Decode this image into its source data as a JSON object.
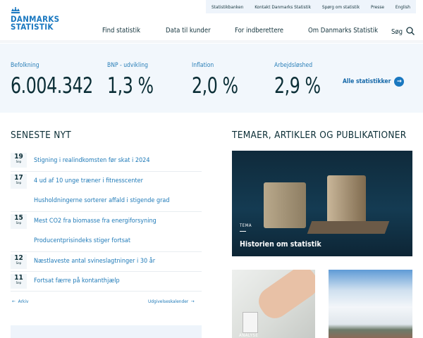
{
  "utility_nav": [
    "Statistikbanken",
    "Kontakt Danmarks Statistik",
    "Spørg om statistik",
    "Presse",
    "English"
  ],
  "logo": {
    "line1": "DANMARKS",
    "line2": "STATISTIK"
  },
  "main_nav": [
    "Find statistik",
    "Data til kunder",
    "For indberettere",
    "Om Danmarks Statistik"
  ],
  "search_label": "Søg",
  "stats": [
    {
      "label": "Befolkning",
      "value": "6.004.342"
    },
    {
      "label": "BNP - udvikling",
      "value": "1,3 %"
    },
    {
      "label": "Inflation",
      "value": "2,0 %"
    },
    {
      "label": "Arbejdsløshed",
      "value": "2,9 %"
    }
  ],
  "all_stats_label": "Alle statistikker",
  "news": {
    "heading": "SENESTE NYT",
    "items": [
      {
        "day": "19",
        "month": "Sep",
        "title": "Stigning i realindkomsten før skat i 2024"
      },
      {
        "day": "17",
        "month": "Sep",
        "title": "4 ud af 10 unge træner i fitnesscenter"
      },
      {
        "day": "",
        "month": "",
        "title": "Husholdningerne sorterer affald i stigende grad"
      },
      {
        "day": "15",
        "month": "Sep",
        "title": "Mest CO2 fra biomasse fra energiforsyning"
      },
      {
        "day": "",
        "month": "",
        "title": "Producentprisindeks stiger fortsat"
      },
      {
        "day": "12",
        "month": "Sep",
        "title": "Næstlaveste antal svineslagtninger i 30 år"
      },
      {
        "day": "11",
        "month": "Sep",
        "title": "Fortsat færre på kontanthjælp"
      }
    ],
    "archive": "Arkiv",
    "calendar": "Udgivelseskalender"
  },
  "themes": {
    "heading": "TEMAER, ARTIKLER OG PUBLIKATIONER",
    "feature": {
      "tag": "TEMA",
      "title": "Historien om statistik"
    },
    "card1_tag": "ANALYSE"
  }
}
